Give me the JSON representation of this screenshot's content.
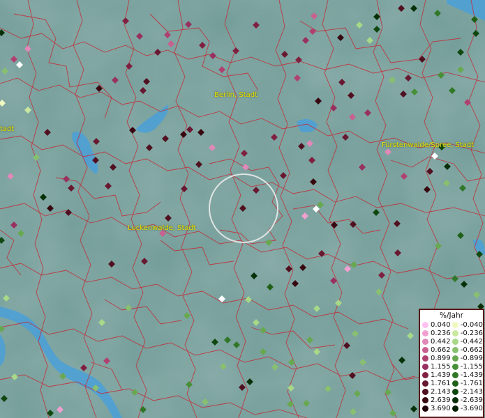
{
  "map": {
    "cities": [
      {
        "name": "Berlin, Stadt"
      },
      {
        "name": "Fürstenwalde/Spree, Stadt"
      },
      {
        "name": "Luckenwalde, Stadt"
      },
      {
        "name": "tadt"
      }
    ]
  },
  "legend": {
    "title": "%/Jahr",
    "positive": [
      {
        "label": "0.040",
        "color": "#ffc0f0"
      },
      {
        "label": "0.236",
        "color": "#f0a0d0"
      },
      {
        "label": "0.442",
        "color": "#e088b8"
      },
      {
        "label": "0.662",
        "color": "#c86090"
      },
      {
        "label": "0.899",
        "color": "#b04070"
      },
      {
        "label": "1.155",
        "color": "#983060"
      },
      {
        "label": "1.439",
        "color": "#802040"
      },
      {
        "label": "1.761",
        "color": "#681830"
      },
      {
        "label": "2.143",
        "color": "#501020"
      },
      {
        "label": "2.639",
        "color": "#380810"
      },
      {
        "label": "3.690",
        "color": "#200008"
      }
    ],
    "negative": [
      {
        "label": "-0.040",
        "color": "#f0f8c0"
      },
      {
        "label": "-0.236",
        "color": "#c8e8a0"
      },
      {
        "label": "-0.442",
        "color": "#a8d888"
      },
      {
        "label": "-0.662",
        "color": "#88c070"
      },
      {
        "label": "-0.899",
        "color": "#68a850"
      },
      {
        "label": "-1.155",
        "color": "#489038"
      },
      {
        "label": "-1.439",
        "color": "#307828"
      },
      {
        "label": "-1.761",
        "color": "#206018"
      },
      {
        "label": "-2.143",
        "color": "#104810"
      },
      {
        "label": "-2.639",
        "color": "#083008"
      },
      {
        "label": "-3.690",
        "color": "#002000"
      }
    ]
  }
}
